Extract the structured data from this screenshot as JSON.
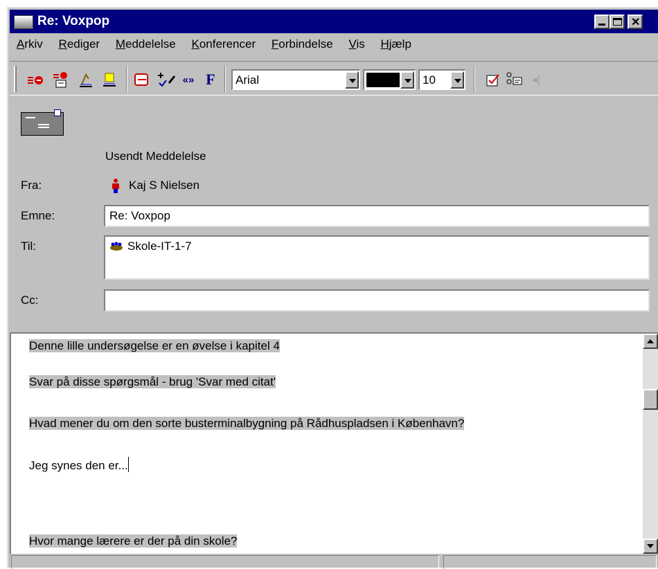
{
  "window": {
    "title": "Re: Voxpop"
  },
  "menubar": {
    "items": [
      {
        "label": "Arkiv",
        "key": "A"
      },
      {
        "label": "Rediger",
        "key": "R"
      },
      {
        "label": "Meddelelse",
        "key": "M"
      },
      {
        "label": "Konferencer",
        "key": "K"
      },
      {
        "label": "Forbindelse",
        "key": "F"
      },
      {
        "label": "Vis",
        "key": "V"
      },
      {
        "label": "Hjælp",
        "key": "H"
      }
    ]
  },
  "toolbar": {
    "font": "Arial",
    "size": "10",
    "color": "#000000",
    "bold_label": "F",
    "quote_label": "«»",
    "icons": [
      "send-icon",
      "send-later-icon",
      "signature-icon",
      "address-book-icon",
      "attach-icon",
      "spell-check-icon",
      "quote-icon",
      "bold-icon",
      "check-icon",
      "address-icon",
      "disabled-icon"
    ]
  },
  "header": {
    "status": "Usendt Meddelelse",
    "from_label": "Fra:",
    "from_value": "Kaj S Nielsen",
    "subject_label": "Emne:",
    "subject_value": "Re: Voxpop",
    "to_label": "Til:",
    "to_value": "Skole-IT-1-7",
    "cc_label": "Cc:",
    "cc_value": ""
  },
  "body": {
    "lines": [
      "Denne lille undersøgelse er en øvelse i kapitel 4",
      "Svar på disse spørgsmål - brug 'Svar med citat'",
      "Hvad mener du om den sorte busterminalbygning på Rådhuspladsen i København?",
      "Jeg synes den er...",
      "Hvor mange lærere er der på din skole?"
    ]
  }
}
